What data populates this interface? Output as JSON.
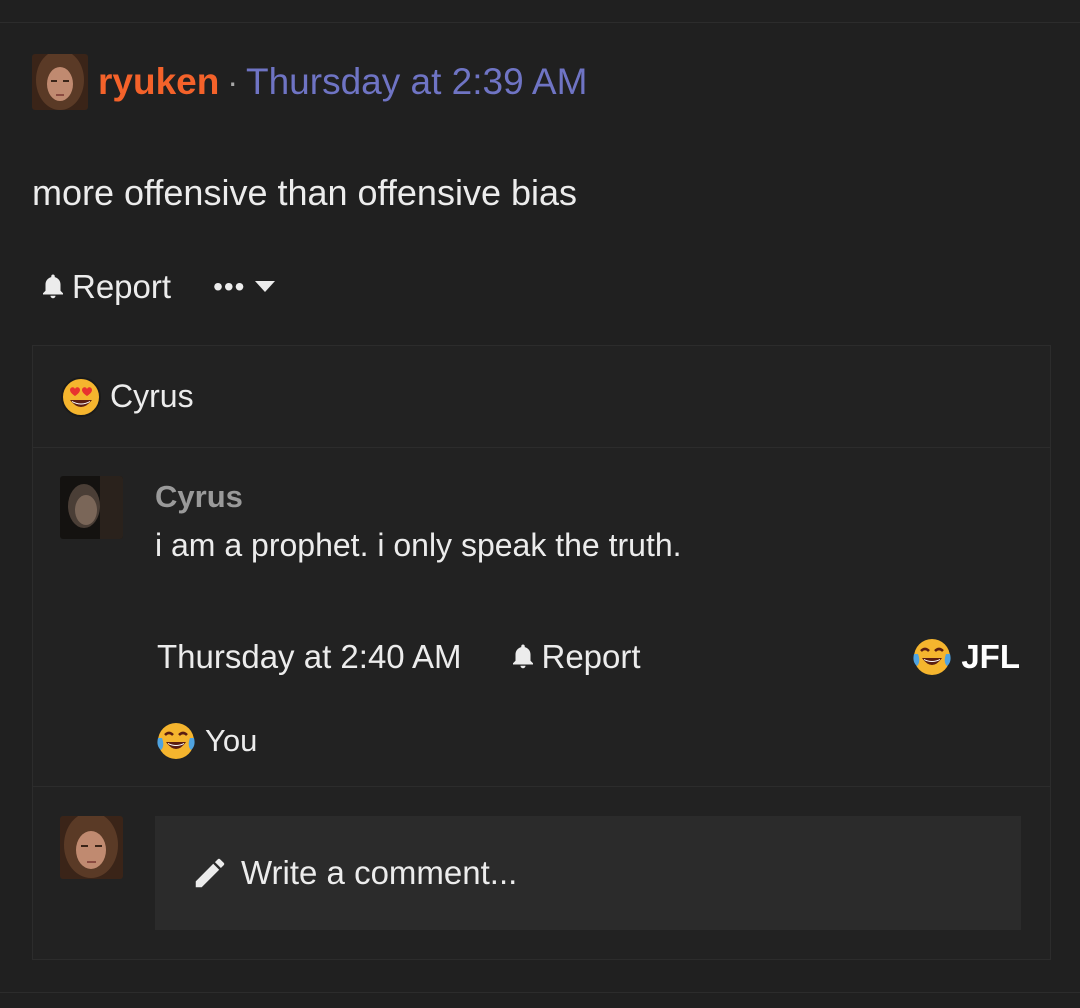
{
  "post": {
    "author": "ryuken",
    "separator": "·",
    "time": "Thursday at 2:39 AM",
    "body": "more offensive than offensive bias",
    "actions": {
      "report_label": "Report",
      "more_label": "•••"
    }
  },
  "reactions": {
    "icon": "heart-eyes-emoji",
    "names": "Cyrus"
  },
  "comment": {
    "author": "Cyrus",
    "text": "i am a prophet. i only speak the truth.",
    "time": "Thursday at 2:40 AM",
    "report_label": "Report",
    "reaction_button": {
      "icon": "crying-laughing-emoji",
      "label": "JFL"
    },
    "reaction_summary": {
      "icon": "crying-laughing-emoji",
      "label": "You"
    }
  },
  "composer": {
    "icon": "pencil-icon",
    "placeholder": "Write a comment..."
  },
  "colors": {
    "background": "#202020",
    "author_accent": "#f4622a",
    "timestamp": "#6f74c4",
    "input_bg": "#2b2b2b"
  }
}
